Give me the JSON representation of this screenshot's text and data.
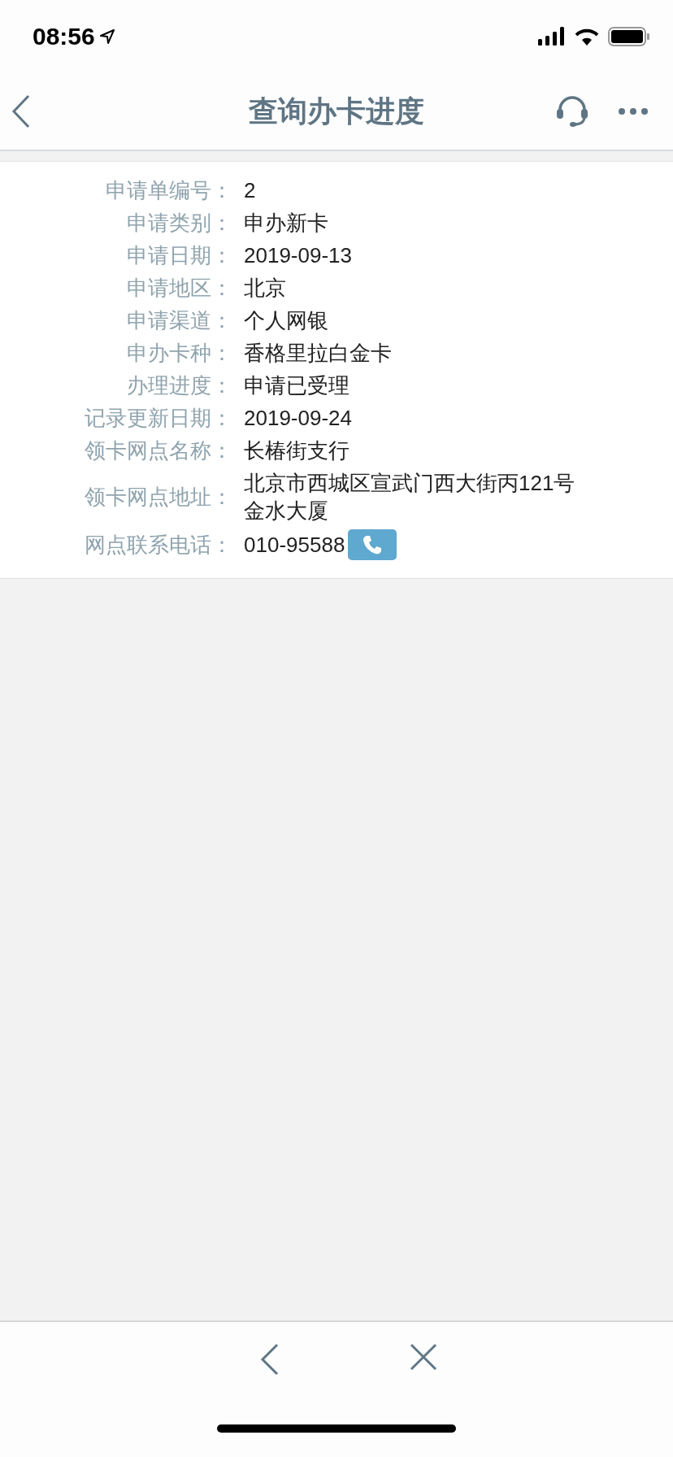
{
  "status_bar": {
    "time": "08:56"
  },
  "header": {
    "title": "查询办卡进度"
  },
  "details": [
    {
      "label": "申请单编号：",
      "value": "2",
      "kind": "text"
    },
    {
      "label": "申请类别：",
      "value": "申办新卡",
      "kind": "text"
    },
    {
      "label": "申请日期：",
      "value": "2019-09-13",
      "kind": "text"
    },
    {
      "label": "申请地区：",
      "value": "北京",
      "kind": "text"
    },
    {
      "label": "申请渠道：",
      "value": "个人网银",
      "kind": "text"
    },
    {
      "label": "申办卡种：",
      "value": "香格里拉白金卡",
      "kind": "text"
    },
    {
      "label": "办理进度：",
      "value": "申请已受理",
      "kind": "text"
    },
    {
      "label": "记录更新日期：",
      "value": "2019-09-24",
      "kind": "text"
    },
    {
      "label": "领卡网点名称：",
      "value": "长椿街支行",
      "kind": "text"
    },
    {
      "label": "领卡网点地址：",
      "value": "北京市西城区宣武门西大街丙121号金水大厦",
      "kind": "text"
    },
    {
      "label": "网点联系电话：",
      "value": "010-95588",
      "kind": "phone"
    }
  ]
}
